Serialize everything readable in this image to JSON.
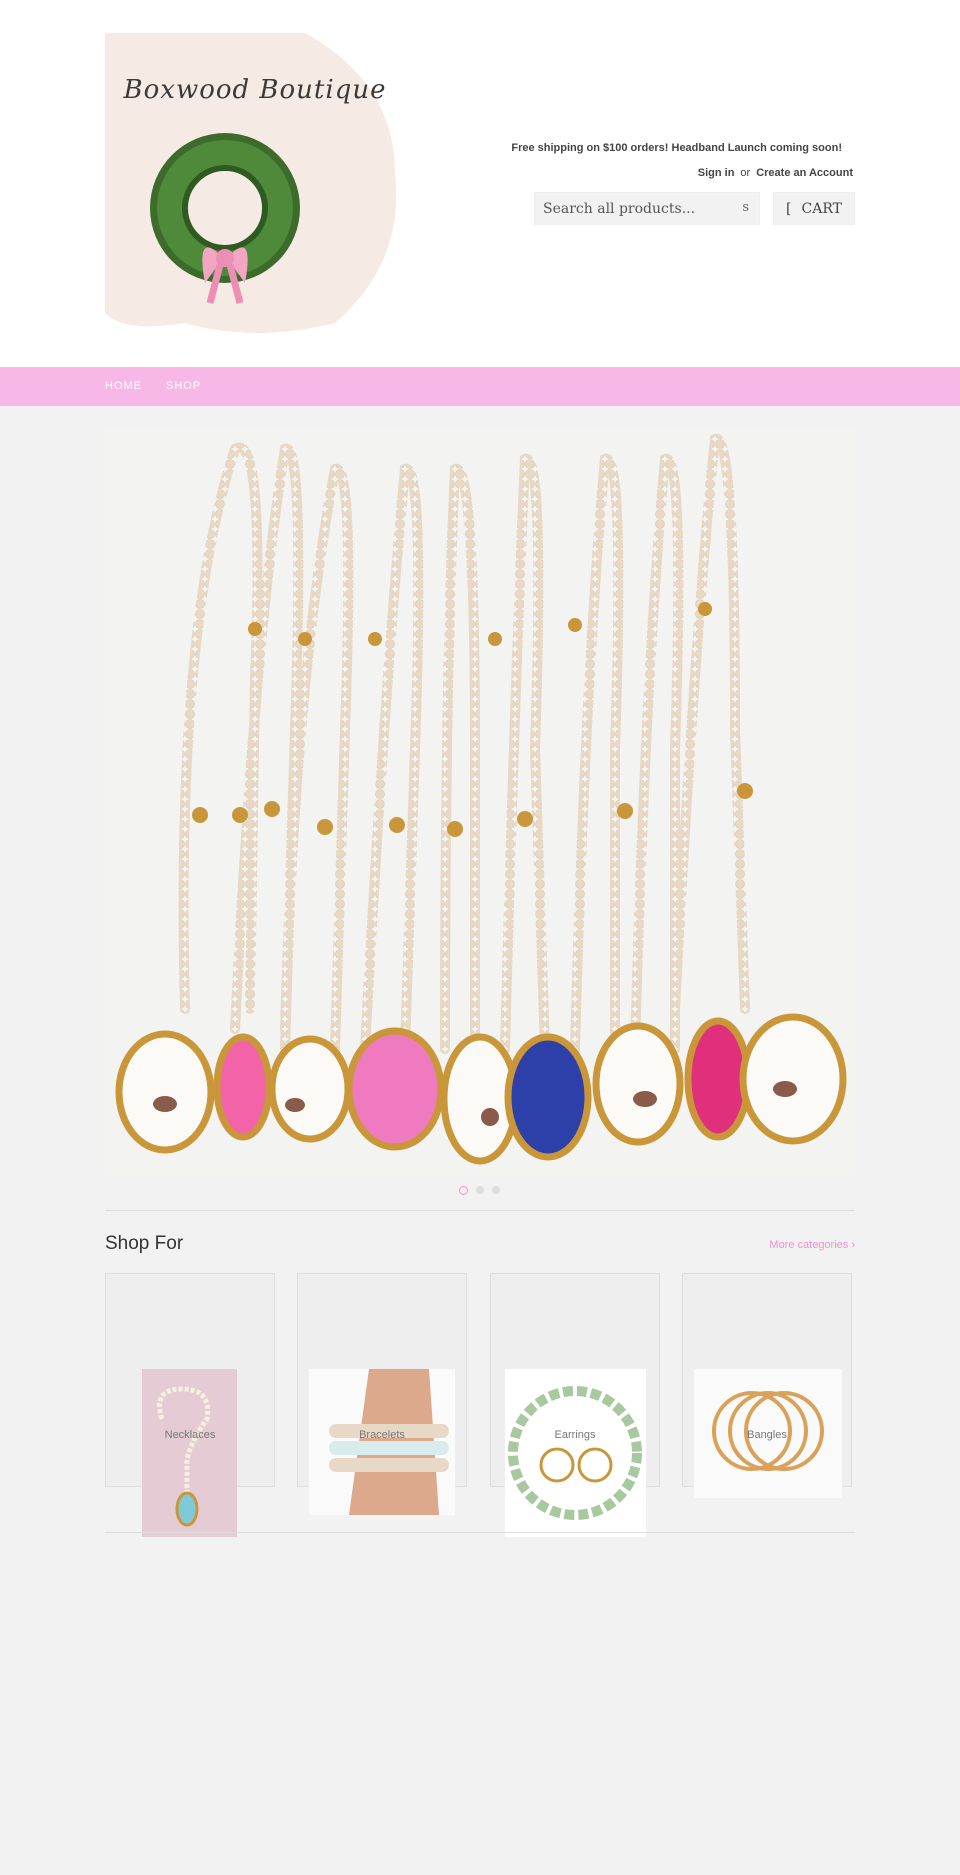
{
  "header": {
    "logo_text": "Boxwood Boutique",
    "announcement": "Free shipping on $100 orders! Headband Launch coming soon!",
    "sign_in": "Sign in",
    "or": "or",
    "create_account": "Create an Account",
    "search_placeholder": "Search all products...",
    "search_button": "s",
    "cart_icon": "[",
    "cart_label": "CART"
  },
  "nav": {
    "items": [
      {
        "label": "HOME"
      },
      {
        "label": "SHOP"
      }
    ],
    "background": "#f7b8e7"
  },
  "slideshow": {
    "slide_count": 3,
    "active_index": 0
  },
  "shop_for": {
    "title": "Shop For",
    "more_link": "More categories ›",
    "categories": [
      {
        "label": "Necklaces"
      },
      {
        "label": "Bracelets"
      },
      {
        "label": "Earrings"
      },
      {
        "label": "Bangles"
      }
    ]
  },
  "colors": {
    "accent": "#f08fd4",
    "nav_pink": "#f7b8e7",
    "page_bg": "#f2f2f2"
  }
}
